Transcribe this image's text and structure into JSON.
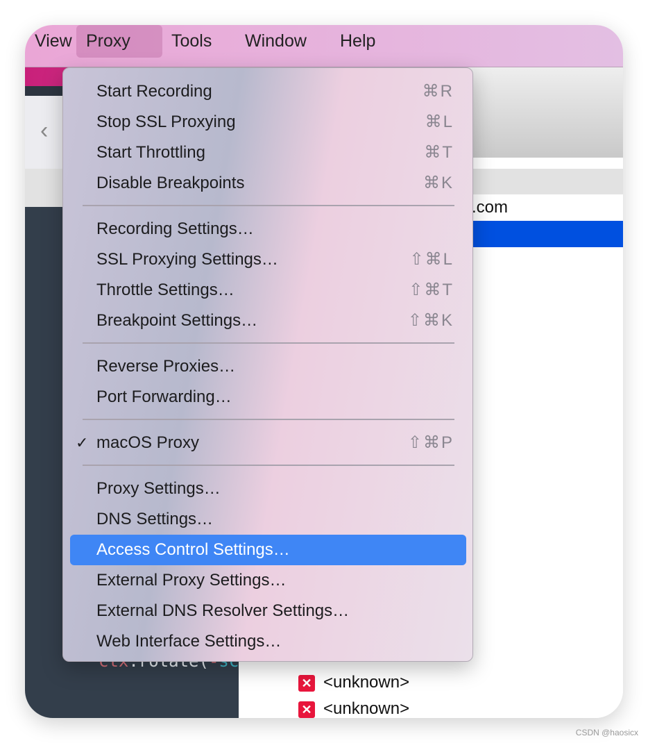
{
  "menubar": {
    "items": [
      "View",
      "Proxy",
      "Tools",
      "Window",
      "Help"
    ],
    "active": "Proxy"
  },
  "list": {
    "domain_fragment": ".com",
    "rows": [
      "<unknown>",
      "<unknown>"
    ]
  },
  "code": {
    "obj": "ctx",
    "method": ".rotate(",
    "neg": "-",
    "arg": "sc"
  },
  "menu": {
    "items": [
      {
        "label": "Start Recording",
        "shortcut": "⌘R"
      },
      {
        "label": "Stop SSL Proxying",
        "shortcut": "⌘L"
      },
      {
        "label": "Start Throttling",
        "shortcut": "⌘T"
      },
      {
        "label": "Disable Breakpoints",
        "shortcut": "⌘K"
      },
      {
        "label": "Recording Settings…",
        "shortcut": ""
      },
      {
        "label": "SSL Proxying Settings…",
        "shortcut": "⇧⌘L"
      },
      {
        "label": "Throttle Settings…",
        "shortcut": "⇧⌘T"
      },
      {
        "label": "Breakpoint Settings…",
        "shortcut": "⇧⌘K"
      },
      {
        "label": "Reverse Proxies…",
        "shortcut": ""
      },
      {
        "label": "Port Forwarding…",
        "shortcut": ""
      },
      {
        "label": "macOS Proxy",
        "shortcut": "⇧⌘P",
        "checked": true,
        "check": "✓"
      },
      {
        "label": "Proxy Settings…",
        "shortcut": ""
      },
      {
        "label": "DNS Settings…",
        "shortcut": ""
      },
      {
        "label": "Access Control Settings…",
        "shortcut": "",
        "highlighted": true
      },
      {
        "label": "External Proxy Settings…",
        "shortcut": ""
      },
      {
        "label": "External DNS Resolver Settings…",
        "shortcut": ""
      },
      {
        "label": "Web Interface Settings…",
        "shortcut": ""
      }
    ]
  },
  "colors": {
    "highlight": "#3f86f5",
    "selection": "#0050e0",
    "error": "#e8163c"
  },
  "watermark": "CSDN @haosicx"
}
